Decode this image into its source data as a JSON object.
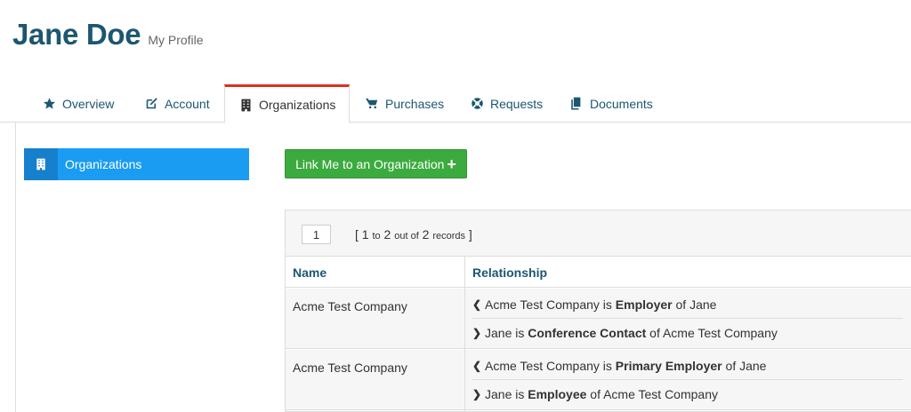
{
  "header": {
    "name": "Jane Doe",
    "subtitle": "My Profile"
  },
  "tabs": [
    {
      "label": "Overview",
      "icon": "star-icon"
    },
    {
      "label": "Account",
      "icon": "edit-icon"
    },
    {
      "label": "Organizations",
      "icon": "building-icon",
      "active": true
    },
    {
      "label": "Purchases",
      "icon": "cart-icon"
    },
    {
      "label": "Requests",
      "icon": "lifebuoy-icon"
    },
    {
      "label": "Documents",
      "icon": "documents-icon"
    }
  ],
  "sidebar": {
    "items": [
      {
        "label": "Organizations",
        "icon": "building-icon"
      }
    ]
  },
  "actions": {
    "link_label": "Link Me to an Organization",
    "link_icon": "+"
  },
  "pager": {
    "page": "1",
    "open": "[",
    "from": "1",
    "to_word": "to",
    "to": "2",
    "out_word": "out of",
    "total": "2",
    "records_word": "records",
    "close": "]"
  },
  "table": {
    "headers": [
      "Name",
      "Relationship"
    ],
    "rows": [
      {
        "name": "Acme Test Company",
        "relationships": [
          {
            "direction": "left",
            "pre": "Acme Test Company is",
            "bold": "Employer",
            "post": "of Jane"
          },
          {
            "direction": "right",
            "pre": "Jane is",
            "bold": "Conference Contact",
            "post": "of Acme Test Company"
          }
        ]
      },
      {
        "name": "Acme Test Company",
        "relationships": [
          {
            "direction": "left",
            "pre": "Acme Test Company is",
            "bold": "Primary Employer",
            "post": "of Jane"
          },
          {
            "direction": "right",
            "pre": "Jane is",
            "bold": "Employee",
            "post": "of Acme Test Company"
          }
        ]
      }
    ]
  },
  "colors": {
    "accent": "#1d5670",
    "tab_active_border": "#d9321f",
    "sidebar_active": "#1a9cf2",
    "button_green": "#3cab3f"
  }
}
